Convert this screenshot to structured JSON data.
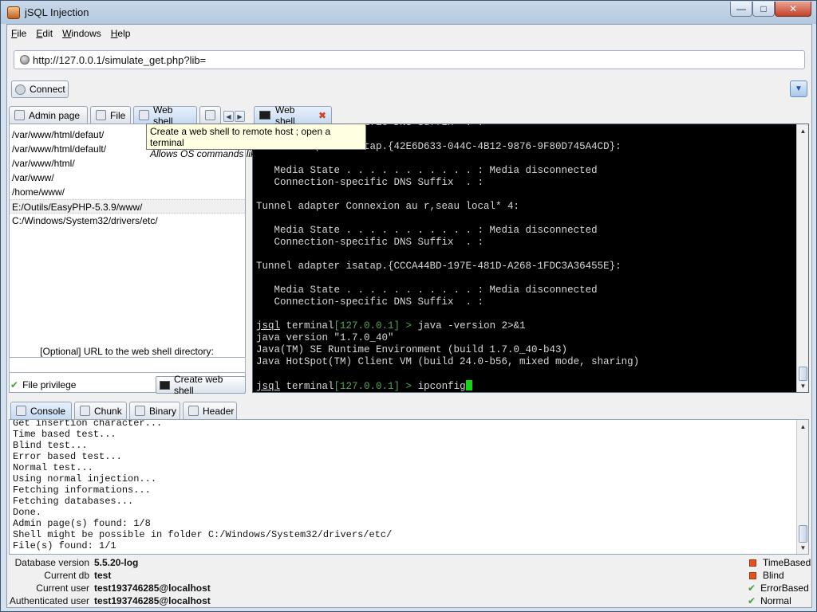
{
  "window": {
    "title": "jSQL Injection"
  },
  "menu": [
    "File",
    "Edit",
    "Windows",
    "Help"
  ],
  "url": {
    "value": "http://127.0.0.1/simulate_get.php?lib="
  },
  "toolbar": {
    "connect_label": "Connect"
  },
  "left_tabs": [
    {
      "label": "Admin page",
      "icon": "admin-page-icon"
    },
    {
      "label": "File",
      "icon": "file-icon"
    },
    {
      "label": "Web shell",
      "icon": "web-shell-icon",
      "active": true
    }
  ],
  "right_tab": {
    "label": "Web shell",
    "icon": "terminal-icon"
  },
  "tooltip": {
    "line1": "Create a web shell to remote host ; open a terminal",
    "line2": "Allows OS commands like ipconfig/ifconfig"
  },
  "paths": [
    "/var/www/html/defaut/",
    "/var/www/html/default/",
    "/var/www/html/",
    "/var/www/",
    "/home/www/",
    "E:/Outils/EasyPHP-5.3.9/www/",
    "C:/Windows/System32/drivers/etc/"
  ],
  "selected_path_index": 5,
  "webshell": {
    "optional_label": "[Optional] URL to the web shell directory:",
    "privilege_label": "File privilege",
    "create_button": "Create web shell"
  },
  "terminal": {
    "lines": [
      "   Connection-specific DNS Suffix  . :",
      "",
      "Tunnel adapter isatap.{42E6D633-044C-4B12-9876-9F80D745A4CD}:",
      "",
      "   Media State . . . . . . . . . . . : Media disconnected",
      "   Connection-specific DNS Suffix  . :",
      "",
      "Tunnel adapter Connexion au r,seau local* 4:",
      "",
      "   Media State . . . . . . . . . . . : Media disconnected",
      "   Connection-specific DNS Suffix  . :",
      "",
      "Tunnel adapter isatap.{CCCA44BD-197E-481D-A268-1FDC3A36455E}:",
      "",
      "   Media State . . . . . . . . . . . : Media disconnected",
      "   Connection-specific DNS Suffix  . :",
      ""
    ],
    "prompt_user": "jsql",
    "prompt_word": "terminal",
    "prompt_host": "[127.0.0.1] >",
    "command1": "java -version 2>&1",
    "output1": [
      "java version \"1.7.0_40\"",
      "Java(TM) SE Runtime Environment (build 1.7.0_40-b43)",
      "Java HotSpot(TM) Client VM (build 24.0-b56, mixed mode, sharing)",
      ""
    ],
    "command2": "ipconfig"
  },
  "bottom_tabs": [
    {
      "label": "Console",
      "active": true
    },
    {
      "label": "Chunk"
    },
    {
      "label": "Binary"
    },
    {
      "label": "Header"
    }
  ],
  "console_lines": [
    "Get insertion character...",
    "Time based test...",
    "Blind test...",
    "Error based test...",
    "Normal test...",
    "Using normal injection...",
    "Fetching informations...",
    "Fetching databases...",
    "Done.",
    "Admin page(s) found: 1/8",
    "Shell might be possible in folder C:/Windows/System32/drivers/etc/",
    "File(s) found: 1/1"
  ],
  "status": {
    "db_version_label": "Database version",
    "db_version": "5.5.20-log",
    "current_db_label": "Current db",
    "current_db": "test",
    "current_user_label": "Current user",
    "current_user": "test193746285@localhost",
    "auth_user_label": "Authenticated user",
    "auth_user": "test193746285@localhost"
  },
  "strategies": [
    {
      "label": "TimeBased",
      "state": "red"
    },
    {
      "label": "Blind",
      "state": "red"
    },
    {
      "label": "ErrorBased",
      "state": "check"
    },
    {
      "label": "Normal",
      "state": "check"
    }
  ],
  "colors": {
    "terminal_bg": "#000000",
    "prompt_host": "#53a653",
    "cursor": "#18d418",
    "strategy_off": "#e8501c",
    "strategy_ok": "#3da23a"
  }
}
